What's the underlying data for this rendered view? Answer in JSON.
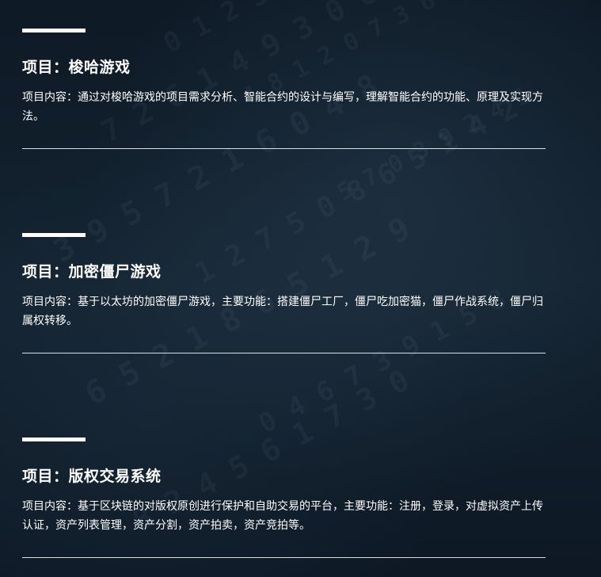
{
  "projects": [
    {
      "title": "项目：梭哈游戏",
      "description": "项目内容：通过对梭哈游戏的项目需求分析、智能合约的设计与编写，理解智能合约的功能、原理及实现方法。"
    },
    {
      "title": "项目：加密僵尸游戏",
      "description": "项目内容：基于以太坊的加密僵尸游戏，主要功能：搭建僵尸工厂，僵尸吃加密猫，僵尸作战系统，僵尸归属权转移。"
    },
    {
      "title": "项目：版权交易系统",
      "description": "项目内容：基于区块链的对版权原创进行保护和自助交易的平台，主要功能：注册，登录，对虚拟资产上传认证，资产列表管理，资产分割，资产拍卖，资产竞拍等。"
    }
  ],
  "colors": {
    "background": "#0f1c29",
    "text": "#ffffff",
    "accent": "#ffffff"
  }
}
